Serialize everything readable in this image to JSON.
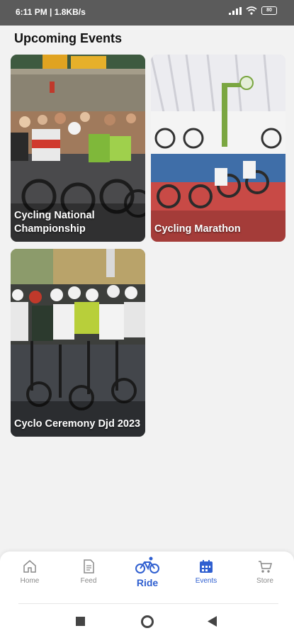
{
  "status_bar": {
    "time_text": "6:11 PM | 1.8KB/s",
    "battery": "80"
  },
  "page": {
    "title": "Upcoming Events"
  },
  "events": [
    {
      "title": "Cycling National Championship"
    },
    {
      "title": "Cycling Marathon"
    },
    {
      "title": "Cyclo Ceremony Djd 2023"
    }
  ],
  "bottom_nav": {
    "home": "Home",
    "feed": "Feed",
    "ride": "Ride",
    "events": "Events",
    "store": "Store"
  },
  "colors": {
    "accent": "#2f5fd0",
    "inactive": "#8a8a8a"
  }
}
